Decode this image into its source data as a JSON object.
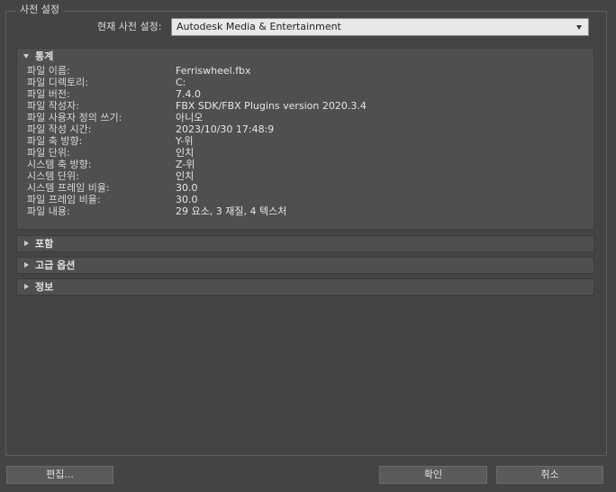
{
  "preset": {
    "group_title": "사전 설정",
    "label": "현재 사전 설정:",
    "selected": "Autodesk Media & Entertainment"
  },
  "stats": {
    "title": "통계",
    "rows": [
      {
        "label": "파일 이름:",
        "value": "Ferriswheel.fbx"
      },
      {
        "label": "파일 디렉토리:",
        "value": "C:"
      },
      {
        "label": "파일 버전:",
        "value": "7.4.0"
      },
      {
        "label": "파일 작성자:",
        "value": "FBX SDK/FBX Plugins version 2020.3.4"
      },
      {
        "label": "파일 사용자 정의 쓰기:",
        "value": "아니오"
      },
      {
        "label": "파일 작성 시간:",
        "value": "2023/10/30  17:48:9"
      },
      {
        "label": "파일 축 방향:",
        "value": "Y-위"
      },
      {
        "label": "파일 단위:",
        "value": "인치"
      },
      {
        "label": "시스템 축 방향:",
        "value": "Z-위"
      },
      {
        "label": "시스템 단위:",
        "value": "인치"
      },
      {
        "label": "시스템 프레임 비율:",
        "value": "30.0"
      },
      {
        "label": "파일 프레임 비율:",
        "value": "30.0"
      },
      {
        "label": "파일 내용:",
        "value": "29 요소,   3 재질,   4 텍스처"
      }
    ]
  },
  "rollouts": {
    "include": "포함",
    "advanced": "고급 옵션",
    "info": "정보"
  },
  "buttons": {
    "edit": "편집...",
    "ok": "확인",
    "cancel": "취소"
  }
}
